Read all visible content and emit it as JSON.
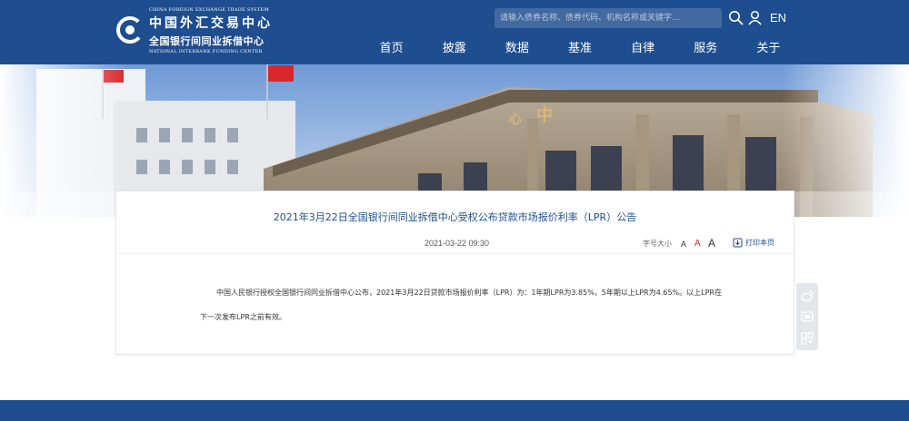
{
  "header": {
    "logo": {
      "en_top": "CHINA FOREIGN EXCHANGE TRADE SYSTEM",
      "cn_name": "中国外汇交易中心",
      "cn_sub": "全国银行间同业拆借中心",
      "en_bottom": "NATIONAL INTERBANK FUNDING CENTER"
    },
    "search_placeholder": "请输入债券名称、债券代码、机构名称或关键字...",
    "search_icon": "search-icon",
    "user_icon": "user-icon",
    "language": "EN",
    "nav": [
      "首页",
      "披露",
      "数据",
      "基准",
      "自律",
      "服务",
      "关于"
    ]
  },
  "article": {
    "title": "2021年3月22日全国银行间同业拆借中心受权公布贷款市场报价利率（LPR）公告",
    "date": "2021-03-22 09:30",
    "font_size_label": "字号大小",
    "font_sizes": [
      "A",
      "A",
      "A"
    ],
    "print_label": "打印本页",
    "print_icon": "print-icon",
    "body": "中国人民银行授权全国银行间同业拆借中心公布，2021年3月22日贷款市场报价利率（LPR）为：1年期LPR为3.85%，5年期以上LPR为4.65%。以上LPR在下一次发布LPR之前有效。"
  },
  "side_tools": [
    "weibo-icon",
    "wechat-icon",
    "qrcode-icon"
  ],
  "colors": {
    "brand": "#1e4e8f",
    "accent_red": "#d9282d",
    "side_bg": "#e3e7ec"
  }
}
